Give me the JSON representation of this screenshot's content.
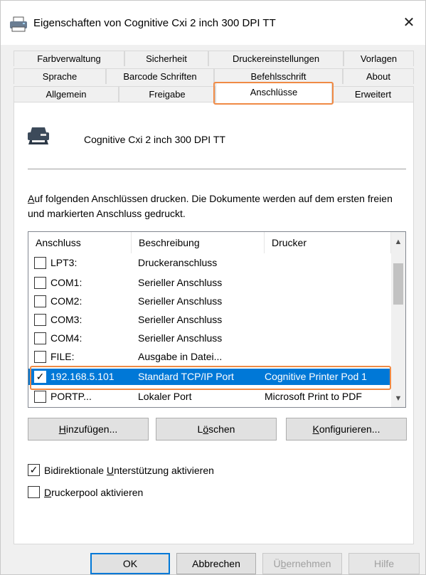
{
  "window": {
    "title": "Eigenschaften von Cognitive Cxi 2 inch 300 DPI TT",
    "close_label": "✕"
  },
  "tabs": {
    "row1": [
      "Farbverwaltung",
      "Sicherheit",
      "Druckereinstellungen",
      "Vorlagen"
    ],
    "row2": [
      "Sprache",
      "Barcode Schriften",
      "Befehlsschrift",
      "About"
    ],
    "row3": [
      "Allgemein",
      "Freigabe",
      "Anschlüsse",
      "Erweitert"
    ],
    "active": "Anschlüsse"
  },
  "printer": {
    "name": "Cognitive Cxi 2 inch 300 DPI TT",
    "icon": "printer-icon"
  },
  "description": {
    "first_letter": "A",
    "rest": "uf folgenden Anschlüssen drucken. Die Dokumente werden auf dem ersten freien und markierten Anschluss gedruckt."
  },
  "ports_table": {
    "columns": [
      "Anschluss",
      "Beschreibung",
      "Drucker"
    ],
    "rows": [
      {
        "checked": false,
        "port": "LPT3:",
        "desc": "Druckeranschluss",
        "printer": ""
      },
      {
        "checked": false,
        "port": "COM1:",
        "desc": "Serieller Anschluss",
        "printer": ""
      },
      {
        "checked": false,
        "port": "COM2:",
        "desc": "Serieller Anschluss",
        "printer": ""
      },
      {
        "checked": false,
        "port": "COM3:",
        "desc": "Serieller Anschluss",
        "printer": ""
      },
      {
        "checked": false,
        "port": "COM4:",
        "desc": "Serieller Anschluss",
        "printer": ""
      },
      {
        "checked": false,
        "port": "FILE:",
        "desc": "Ausgabe in Datei...",
        "printer": ""
      },
      {
        "checked": true,
        "port": "192.168.5.101",
        "desc": "Standard TCP/IP Port",
        "printer": "Cognitive Printer Pod 1",
        "selected": true
      },
      {
        "checked": false,
        "port": "PORTP...",
        "desc": "Lokaler Port",
        "printer": "Microsoft Print to PDF"
      }
    ],
    "check_mark": "✓"
  },
  "port_buttons": {
    "add": {
      "ul": "H",
      "rest": "inzufügen..."
    },
    "delete": {
      "pre": "L",
      "ul": "ö",
      "rest": "schen"
    },
    "configure": {
      "ul": "K",
      "rest": "onfigurieren..."
    }
  },
  "options": {
    "bidi": {
      "checked": true,
      "pre": "Bidirektionale ",
      "ul": "U",
      "rest": "nterstützung aktivieren"
    },
    "pool": {
      "checked": false,
      "ul": "D",
      "rest": "ruckerpool aktivieren"
    }
  },
  "dialog_buttons": {
    "ok": "OK",
    "cancel": "Abbrechen",
    "apply": {
      "pre": "Ü",
      "ul": "b",
      "rest": "ernehmen"
    },
    "help": "Hilfe"
  },
  "colors": {
    "selection": "#0078d7",
    "highlight": "#f08a45"
  }
}
